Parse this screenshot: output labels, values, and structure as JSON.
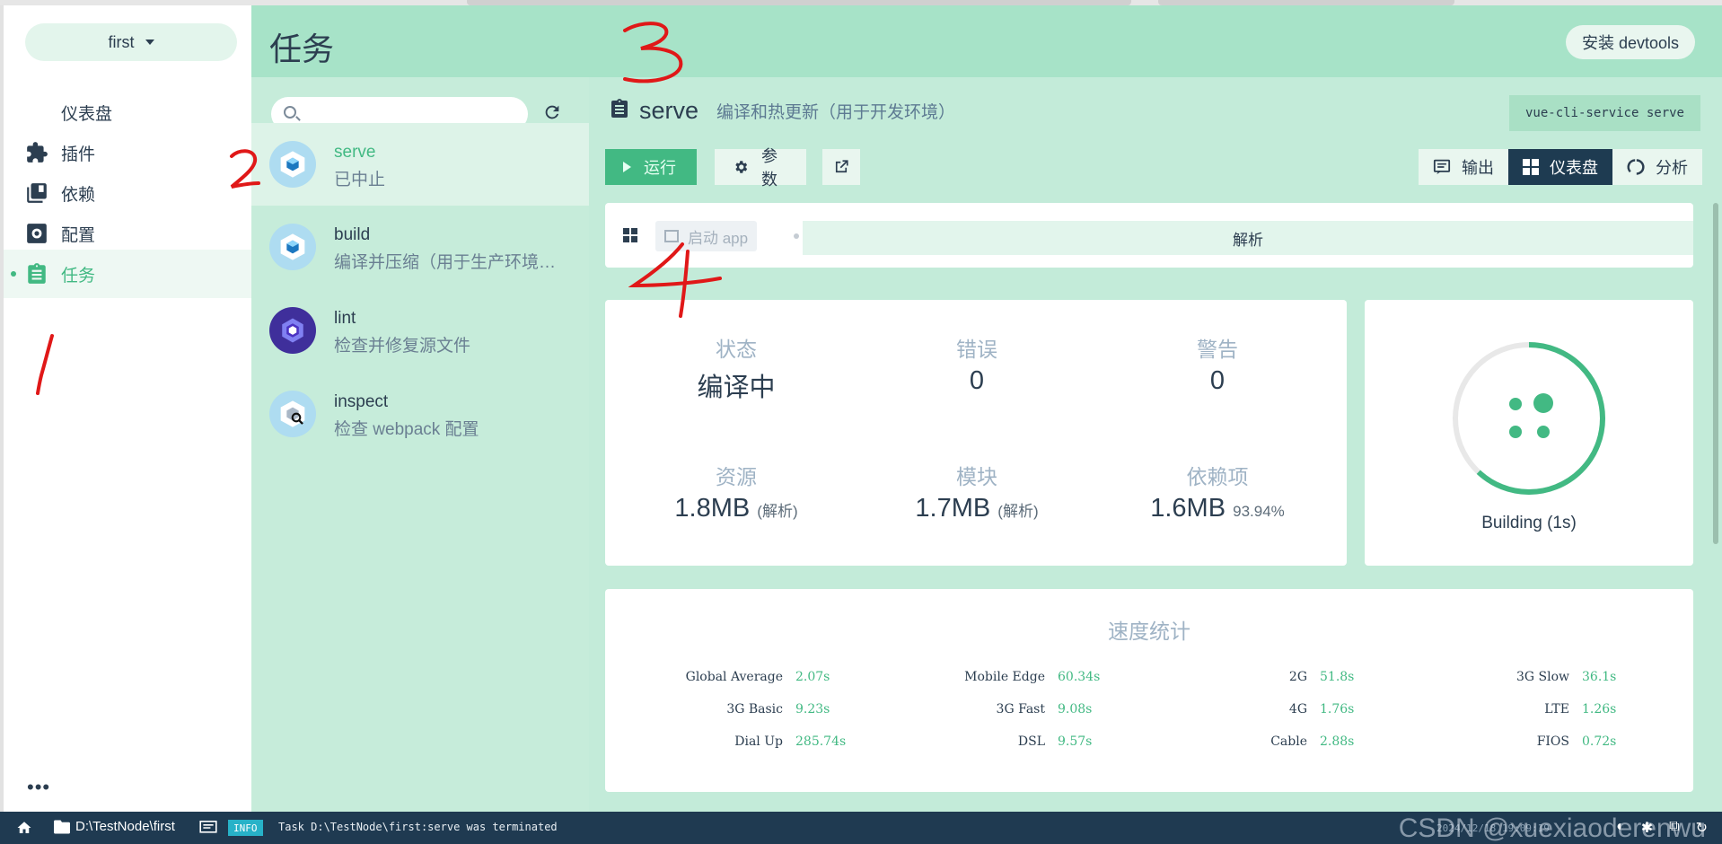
{
  "project": {
    "name": "first"
  },
  "nav": {
    "items": [
      {
        "label": "仪表盘",
        "icon": "dashboard-icon"
      },
      {
        "label": "插件",
        "icon": "puzzle-icon"
      },
      {
        "label": "依赖",
        "icon": "library-books-icon"
      },
      {
        "label": "配置",
        "icon": "settings-box-icon"
      },
      {
        "label": "任务",
        "icon": "clipboard-task-icon",
        "active": true
      }
    ],
    "more": "•••"
  },
  "header": {
    "title": "任务",
    "devtools_label": "安装 devtools"
  },
  "search": {
    "placeholder": ""
  },
  "tasks": [
    {
      "name": "serve",
      "desc": "已中止",
      "active": true
    },
    {
      "name": "build",
      "desc": "编译并压缩（用于生产环境…"
    },
    {
      "name": "lint",
      "desc": "检查并修复源文件"
    },
    {
      "name": "inspect",
      "desc": "检查 webpack 配置"
    }
  ],
  "current_task": {
    "name": "serve",
    "desc": "编译和热更新（用于开发环境）",
    "command": "vue-cli-service serve"
  },
  "actions": {
    "run": "运行",
    "params": "参数"
  },
  "view_tabs": [
    {
      "label": "输出"
    },
    {
      "label": "仪表盘",
      "active": true
    },
    {
      "label": "分析"
    }
  ],
  "widget_bar": {
    "start_app": "启动 app",
    "parse": "解析"
  },
  "stats": {
    "status": {
      "label": "状态",
      "value": "编译中"
    },
    "errors": {
      "label": "错误",
      "value": "0"
    },
    "warnings": {
      "label": "警告",
      "value": "0"
    },
    "assets": {
      "label": "资源",
      "value": "1.8MB",
      "sub": "(解析)"
    },
    "modules": {
      "label": "模块",
      "value": "1.7MB",
      "sub": "(解析)"
    },
    "deps": {
      "label": "依赖项",
      "value": "1.6MB",
      "sub": "93.94%"
    }
  },
  "build": {
    "status": "Building (1s)",
    "progress": 0.62
  },
  "speed": {
    "title": "速度统计",
    "rows": [
      [
        {
          "label": "Global Average",
          "value": "2.07s"
        },
        {
          "label": "Mobile Edge",
          "value": "60.34s"
        },
        {
          "label": "2G",
          "value": "51.8s"
        },
        {
          "label": "3G Slow",
          "value": "36.1s"
        }
      ],
      [
        {
          "label": "3G Basic",
          "value": "9.23s"
        },
        {
          "label": "3G Fast",
          "value": "9.08s"
        },
        {
          "label": "4G",
          "value": "1.76s"
        },
        {
          "label": "LTE",
          "value": "1.26s"
        }
      ],
      [
        {
          "label": "Dial Up",
          "value": "285.74s"
        },
        {
          "label": "DSL",
          "value": "9.57s"
        },
        {
          "label": "Cable",
          "value": "2.88s"
        },
        {
          "label": "FIOS",
          "value": "0.72s"
        }
      ]
    ]
  },
  "statusbar": {
    "path": "D:\\TestNode\\first",
    "level": "INFO",
    "message": "Task D:\\TestNode\\first:serve was terminated",
    "time": "2024/12/18 19:09:19",
    "watermark": "CSDN @xuexiaoderenwu"
  },
  "annotations": {
    "a1": "1",
    "a2": "2",
    "a3": "3",
    "a4": "4"
  },
  "colors": {
    "accent": "#42b983",
    "dark": "#1e3b51",
    "header": "#a7e3c8"
  }
}
